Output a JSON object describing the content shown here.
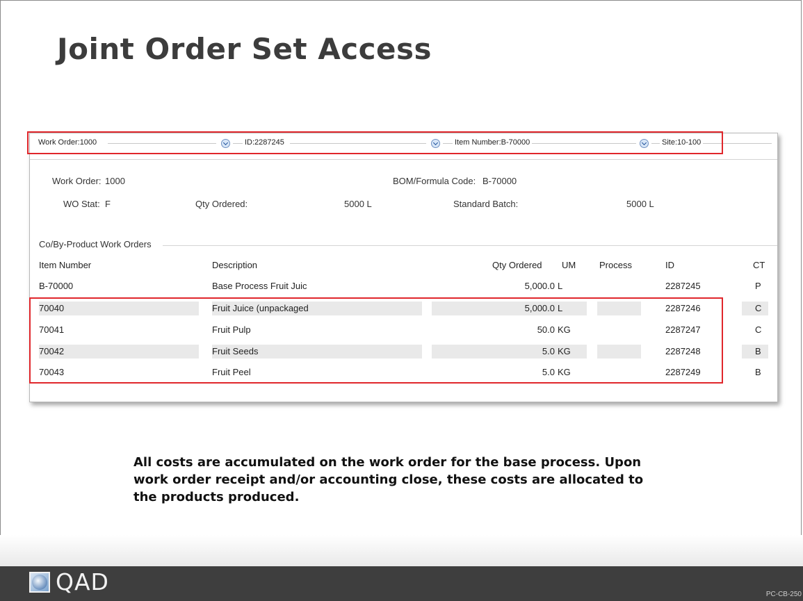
{
  "slide": {
    "title": "Joint Order Set Access",
    "body_text": "All costs are accumulated on the work order for the base process. Upon work order receipt and/or accounting close, these costs are allocated to the products produced.",
    "code": "PC-CB-250"
  },
  "brand": {
    "name": "QAD",
    "accent": "#2f63a3",
    "highlight_color": "#e0262b"
  },
  "field_strip": {
    "work_order": "Work Order:1000",
    "id": "ID:2287245",
    "item_number": "Item Number:B-70000",
    "site": "Site:10-100",
    "dropdown_icon": "chevron-down-icon"
  },
  "header": {
    "work_order_label": "Work Order:",
    "work_order_value": "1000",
    "bom_label": "BOM/Formula Code:",
    "bom_value": "B-70000",
    "wo_stat_label": "WO Stat:",
    "wo_stat_value": "F",
    "qty_ordered_label": "Qty Ordered:",
    "qty_ordered_value": "5000 L",
    "std_batch_label": "Standard Batch:",
    "std_batch_value": "5000 L"
  },
  "co_by_product": {
    "section_label": "Co/By-Product Work Orders",
    "columns": [
      "Item Number",
      "Description",
      "Qty Ordered",
      "UM",
      "Process",
      "ID",
      "CT"
    ],
    "rows": [
      {
        "item": "B-70000",
        "desc": "Base Process Fruit Juic",
        "qty": "5,000.0",
        "um": "L",
        "process": "",
        "id": "2287245",
        "ct": "P"
      },
      {
        "item": "70040",
        "desc": "Fruit Juice (unpackaged",
        "qty": "5,000.0",
        "um": "L",
        "process": "",
        "id": "2287246",
        "ct": "C"
      },
      {
        "item": "70041",
        "desc": "Fruit Pulp",
        "qty": "50.0",
        "um": "KG",
        "process": "",
        "id": "2287247",
        "ct": "C"
      },
      {
        "item": "70042",
        "desc": "Fruit Seeds",
        "qty": "5.0",
        "um": "KG",
        "process": "",
        "id": "2287248",
        "ct": "B"
      },
      {
        "item": "70043",
        "desc": "Fruit Peel",
        "qty": "5.0",
        "um": "KG",
        "process": "",
        "id": "2287249",
        "ct": "B"
      }
    ]
  }
}
